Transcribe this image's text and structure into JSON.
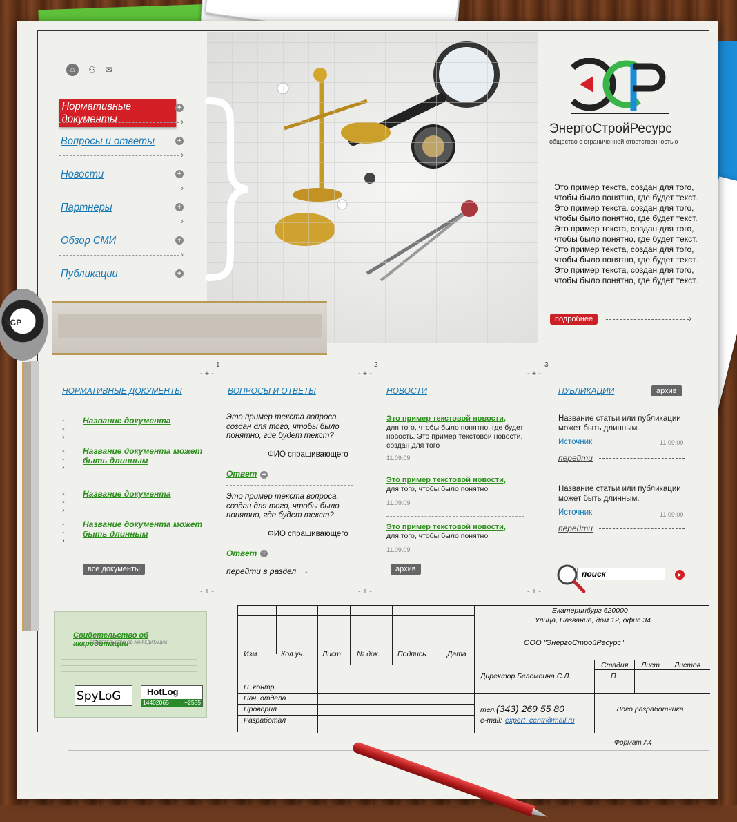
{
  "top_icons": {
    "home": "home-icon",
    "sitemap": "sitemap-icon",
    "mail": "mail-icon"
  },
  "nav": [
    {
      "label": "Нормативные документы",
      "active": true
    },
    {
      "label": "Вопросы и ответы"
    },
    {
      "label": "Новости"
    },
    {
      "label": "Партнеры"
    },
    {
      "label": "Обзор СМИ"
    },
    {
      "label": "Публикации"
    }
  ],
  "brand": {
    "name": "ЭнергоСтройРесурс",
    "subtitle": "общество с ограниченной ответственностью",
    "colors": {
      "red": "#d51f26",
      "green": "#39b54a",
      "blue": "#1a8cd8",
      "dark": "#222222"
    }
  },
  "intro": {
    "text": "Это пример текста, создан для того, чтобы было понятно, где будет текст. Это пример текста, создан для того, чтобы было понятно, где будет текст. Это пример текста, создан для того, чтобы было понятно, где будет текст. Это пример текста, создан для того, чтобы было понятно, где будет текст. Это пример текста, создан для того, чтобы было понятно, где будет текст.",
    "more_label": "подробнее"
  },
  "dial_logo": "ЭСР",
  "col_numbers": [
    "1",
    "2",
    "3"
  ],
  "docs": {
    "title": "НОРМАТИВНЫЕ ДОКУМЕНТЫ",
    "items": [
      "Название документа",
      "Название документа может быть длинным",
      "Название документа",
      "Название документа может быть длинным"
    ],
    "all_label": "все документы"
  },
  "qa": {
    "title": "ВОПРОСЫ И ОТВЕТЫ",
    "items": [
      {
        "question": "Это пример текста вопроса, создан для того, чтобы было понятно, где будет текст?",
        "author": "ФИО спрашивающего",
        "answer": "Ответ"
      },
      {
        "question": "Это пример текста вопроса, создан для того, чтобы было понятно, где будет текст?",
        "author": "ФИО спрашивающего",
        "answer": "Ответ"
      }
    ],
    "go_label": "перейти в раздел"
  },
  "news": {
    "title": "НОВОСТИ",
    "items": [
      {
        "title": "Это пример текстовой новости,",
        "text": "для того, чтобы было понятно, где будет новость. Это пример текстовой новости, создан для того",
        "date": "11.09.09"
      },
      {
        "title": "Это пример текстовой новости,",
        "text": "для того, чтобы было понятно",
        "date": "11.09.09"
      },
      {
        "title": "Это пример текстовой новости,",
        "text": "для того, чтобы было понятно",
        "date": "11.09.09"
      }
    ],
    "archive_label": "архив"
  },
  "pubs": {
    "title": "ПУБЛИКАЦИИ",
    "archive_label": "архив",
    "items": [
      {
        "text": "Название статьи или публикации может быть длинным.",
        "source": "Источник",
        "date": "11.09.09",
        "go": "перейти"
      },
      {
        "text": "Название статьи или публикации может быть длинным.",
        "source": "Источник",
        "date": "11.09.09",
        "go": "перейти"
      }
    ]
  },
  "search": {
    "placeholder": "поиск"
  },
  "cert": {
    "title": "Свидетельство об аккредитации",
    "doc_heading": "СВИДЕТЕЛЬСТВО ОБ АККРЕДИТАЦИИ"
  },
  "counters": {
    "spylog": "SpyLoG",
    "hotlog": "HotLog",
    "hotlog_a": "14402065",
    "hotlog_b": "+2585"
  },
  "stamp": {
    "headers": [
      "Изм.",
      "Кол.уч.",
      "Лист",
      "№ док.",
      "Подпись",
      "Дата"
    ],
    "roles": [
      "Н. контр.",
      "Нач. отдела",
      "Проверил",
      "Разработал"
    ],
    "city": "Екатеринбург 620000",
    "address": "Улица, Название, дом 12, офис 34",
    "company": "ООО \"ЭнергоСтройРесурс\"",
    "director": "Директор Беломоина С.Л.",
    "stage_h": "Стадия",
    "sheet_h": "Лист",
    "sheets_h": "Листов",
    "stage_v": "П",
    "phone_label": "тел.",
    "phone": "(343) 269 55 80",
    "email_label": "e-mail:",
    "email": "expert_centr@mail.ru",
    "dev_logo": "Лого разработчика"
  },
  "format_label": "Формат А4"
}
